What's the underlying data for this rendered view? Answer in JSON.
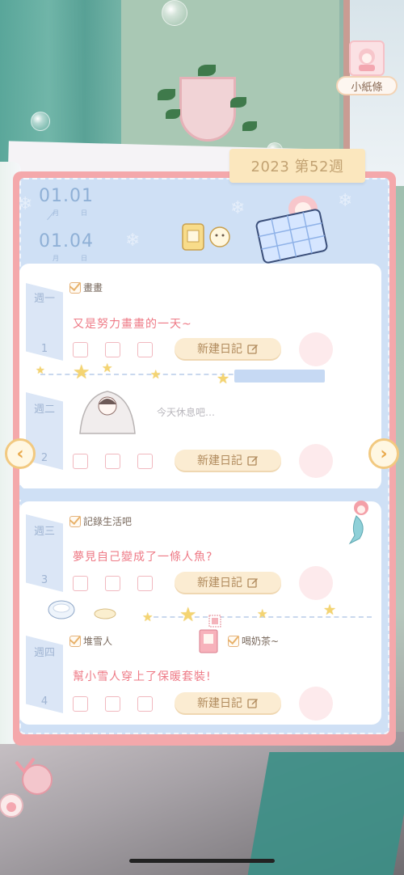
{
  "note_badge": {
    "label": "小紙條"
  },
  "week_header": {
    "title": "2023 第52週"
  },
  "date_range": {
    "start": {
      "month": "01",
      "day": "01",
      "month_unit": "月",
      "day_unit": "日"
    },
    "end": {
      "month": "01",
      "day": "04",
      "month_unit": "月",
      "day_unit": "日"
    }
  },
  "days": [
    {
      "name": "週一",
      "number": "1",
      "checks": [
        {
          "label": "畫畫"
        }
      ],
      "diary": "又是努力畫畫的一天~",
      "button": "新建日記"
    },
    {
      "name": "週二",
      "number": "2",
      "checks": [],
      "diary": "今天休息吧…",
      "button": "新建日記"
    },
    {
      "name": "週三",
      "number": "3",
      "checks": [
        {
          "label": "記錄生活吧"
        }
      ],
      "diary": "夢見自己變成了一條人魚?",
      "button": "新建日記"
    },
    {
      "name": "週四",
      "number": "4",
      "checks": [
        {
          "label": "堆雪人"
        },
        {
          "label": "喝奶茶~"
        }
      ],
      "diary": "幫小雪人穿上了保暖套裝!",
      "button": "新建日記"
    }
  ],
  "nav": {
    "prev_icon": "chevron-left-icon",
    "next_icon": "chevron-right-icon",
    "prev_glyph": "‹",
    "next_glyph": "›"
  },
  "colors": {
    "book_border": "#f4a8ab",
    "page_bg": "#cfe0f5",
    "diary_text": "#ee7a86",
    "button_bg": "#fbecd2"
  }
}
